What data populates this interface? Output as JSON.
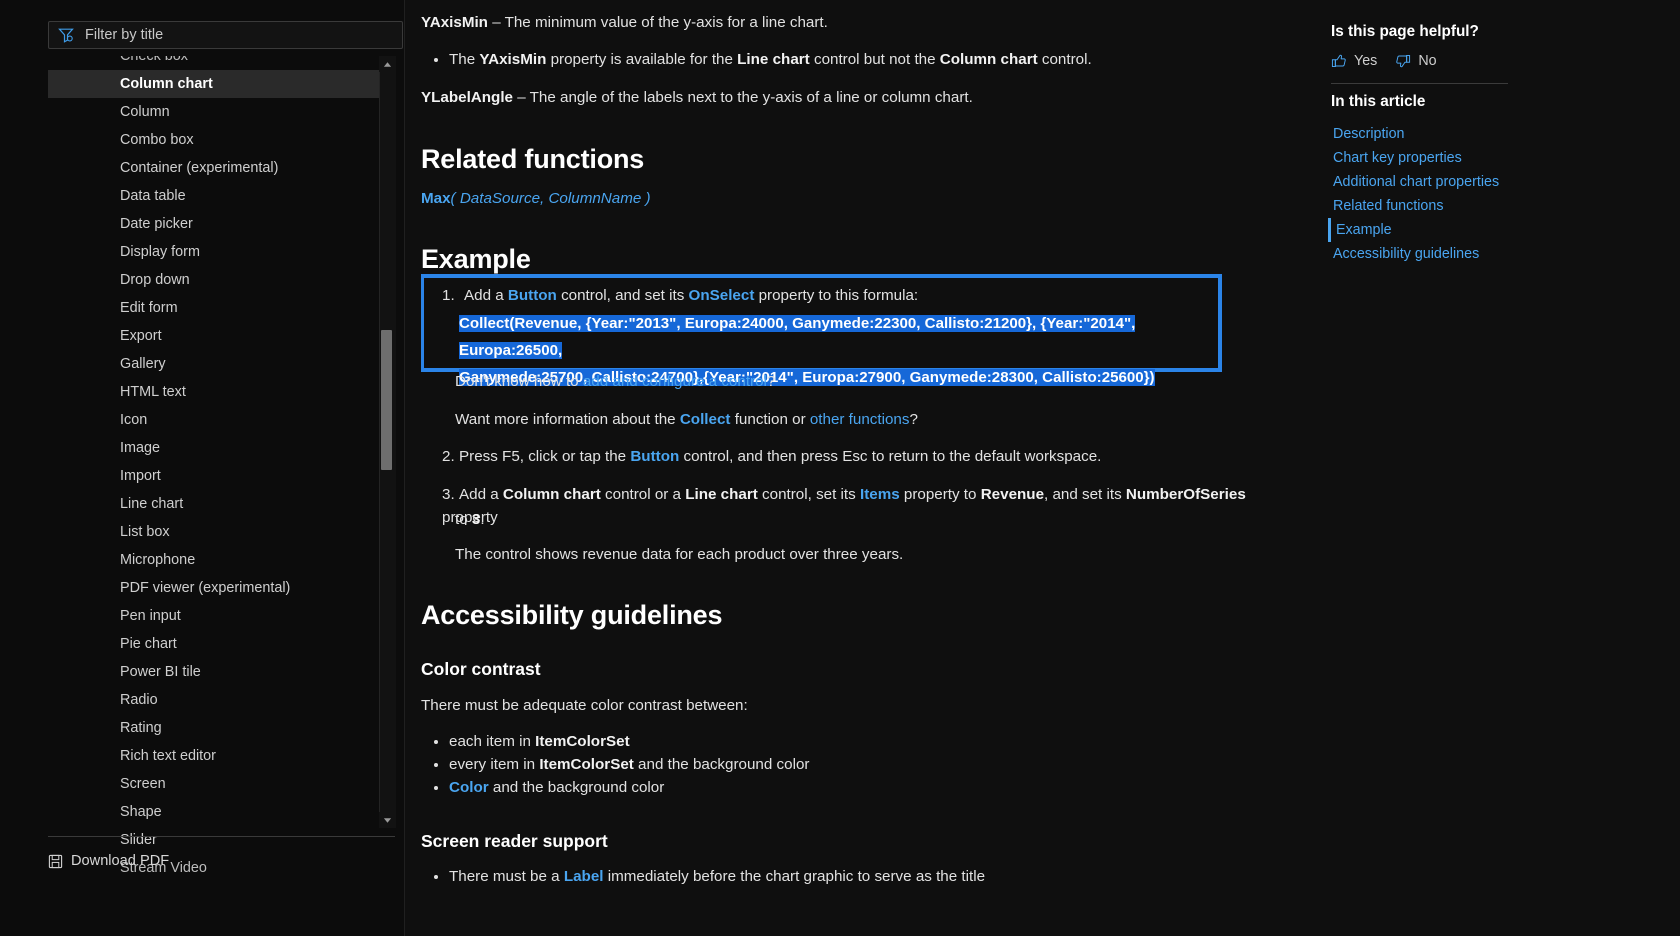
{
  "sidebar": {
    "filter": {
      "placeholder": "Filter by title",
      "value": "",
      "icon": "filter-icon"
    },
    "items": [
      {
        "label": "Check box",
        "active": false,
        "clipped": true
      },
      {
        "label": "Column chart",
        "active": true
      },
      {
        "label": "Column",
        "active": false
      },
      {
        "label": "Combo box",
        "active": false
      },
      {
        "label": "Container (experimental)",
        "active": false
      },
      {
        "label": "Data table",
        "active": false
      },
      {
        "label": "Date picker",
        "active": false
      },
      {
        "label": "Display form",
        "active": false
      },
      {
        "label": "Drop down",
        "active": false
      },
      {
        "label": "Edit form",
        "active": false
      },
      {
        "label": "Export",
        "active": false
      },
      {
        "label": "Gallery",
        "active": false
      },
      {
        "label": "HTML text",
        "active": false
      },
      {
        "label": "Icon",
        "active": false
      },
      {
        "label": "Image",
        "active": false
      },
      {
        "label": "Import",
        "active": false
      },
      {
        "label": "Line chart",
        "active": false
      },
      {
        "label": "List box",
        "active": false
      },
      {
        "label": "Microphone",
        "active": false
      },
      {
        "label": "PDF viewer (experimental)",
        "active": false
      },
      {
        "label": "Pen input",
        "active": false
      },
      {
        "label": "Pie chart",
        "active": false
      },
      {
        "label": "Power BI tile",
        "active": false
      },
      {
        "label": "Radio",
        "active": false
      },
      {
        "label": "Rating",
        "active": false
      },
      {
        "label": "Rich text editor",
        "active": false
      },
      {
        "label": "Screen",
        "active": false
      },
      {
        "label": "Shape",
        "active": false
      },
      {
        "label": "Slider",
        "active": false
      },
      {
        "label": "Stream Video",
        "active": false,
        "clipped": true
      }
    ],
    "download_pdf": "Download PDF"
  },
  "content": {
    "yaxismin_name": "YAxisMin",
    "yaxismin_desc": " – The minimum value of the y-axis for a line chart.",
    "yaxismin_bullet": {
      "pre": "The ",
      "prop": "YAxisMin",
      "mid": " property is available for the ",
      "line_chart": "Line chart",
      "mid2": " control but not the ",
      "column_chart": "Column chart",
      "post": " control."
    },
    "ylabelangle_name": "YLabelAngle",
    "ylabelangle_desc": " – The angle of the labels next to the y-axis of a line or column chart.",
    "related_functions_heading": "Related functions",
    "max_fn": "Max",
    "max_args": "( DataSource, ColumnName )",
    "example_heading": "Example",
    "step1": {
      "number": "1.",
      "pre": "Add a ",
      "button": "Button",
      "mid": " control, and set its ",
      "onselect": "OnSelect",
      "post": " property to this formula:"
    },
    "code_line1": "Collect(Revenue, {Year:\"2013\", Europa:24000, Ganymede:22300, Callisto:21200}, {Year:\"2014\", Europa:26500,",
    "code_line2": "Ganymede:25700, Callisto:24700},{Year:\"2014\", Europa:27900, Ganymede:28300, Callisto:25600})",
    "dontknow": {
      "pre": "Don't know how to ",
      "link": "add and configure a control",
      "post": "?"
    },
    "wantmore": {
      "pre": "Want more information about the ",
      "collect": "Collect",
      "mid": " function or ",
      "link": "other functions",
      "post": "?"
    },
    "step2": {
      "number": "2.",
      "pre": "Press F5, click or tap the ",
      "button": "Button",
      "post": " control, and then press Esc to return to the default workspace."
    },
    "step3": {
      "number": "3.",
      "pre": "Add a ",
      "column_chart": "Column chart",
      "mid": " control or a ",
      "line_chart": "Line chart",
      "mid2": " control, set its ",
      "items": "Items",
      "mid3": " property to ",
      "revenue": "Revenue",
      "mid4": ", and set its ",
      "numberofseries": "NumberOfSeries",
      "mid5": " property",
      "line2_pre": "to ",
      "line2_value": "3",
      "line2_post": "."
    },
    "step3_note": "The control shows revenue data for each product over three years.",
    "accessibility_heading": "Accessibility guidelines",
    "color_contrast_heading": "Color contrast",
    "color_contrast_intro": "There must be adequate color contrast between:",
    "cc_bullet1": {
      "pre": "each item in ",
      "bold": "ItemColorSet"
    },
    "cc_bullet2": {
      "pre": "every item in ",
      "bold": "ItemColorSet",
      "post": " and the background color"
    },
    "cc_bullet3": {
      "link": "Color",
      "post": " and the background color"
    },
    "screen_reader_heading": "Screen reader support",
    "sr_bullet1": {
      "pre": "There must be a ",
      "link": "Label",
      "post": " immediately before the chart graphic to serve as the title"
    }
  },
  "rail": {
    "helpful_title": "Is this page helpful?",
    "yes": "Yes",
    "no": "No",
    "in_this_article": "In this article",
    "toc": [
      {
        "label": "Description",
        "current": false
      },
      {
        "label": "Chart key properties",
        "current": false
      },
      {
        "label": "Additional chart properties",
        "current": false
      },
      {
        "label": "Related functions",
        "current": false
      },
      {
        "label": "Example",
        "current": true
      },
      {
        "label": "Accessibility guidelines",
        "current": false
      }
    ]
  },
  "colors": {
    "accent_link": "#4aa5f0",
    "selection": "#1668d8",
    "focus_border": "#2b84e8",
    "background": "#0f0f0f",
    "sidebar_bg": "#0c0c0c",
    "active_item_bg": "#2a2a2a"
  }
}
